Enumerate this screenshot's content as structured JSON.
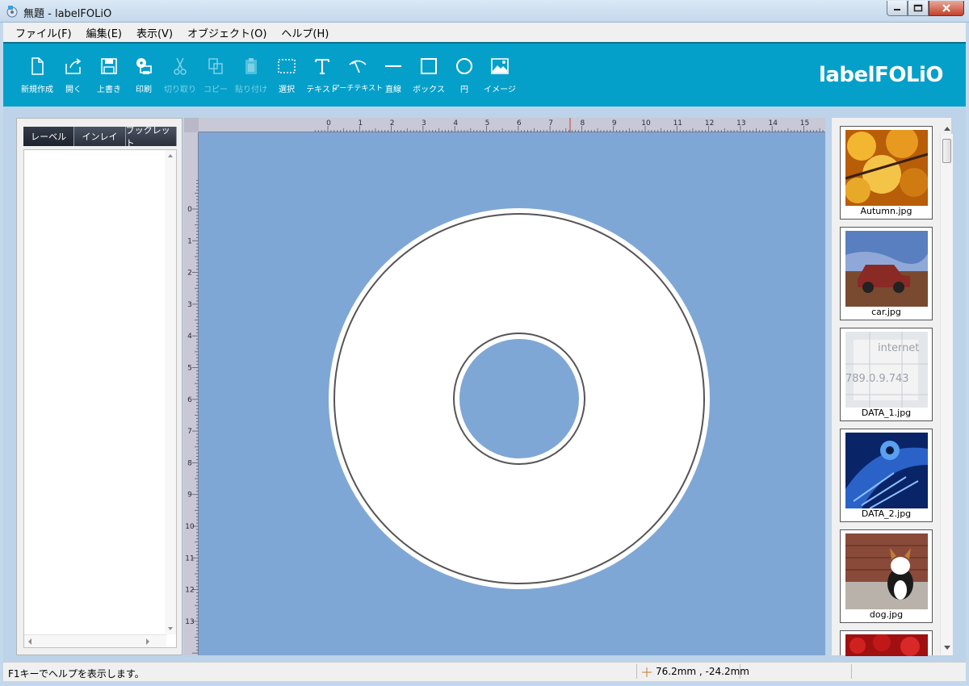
{
  "window": {
    "title": "無題 - labelFOLiO",
    "buttons": [
      "minimize",
      "maximize",
      "close"
    ]
  },
  "menu": [
    "ファイル(F)",
    "編集(E)",
    "表示(V)",
    "オブジェクト(O)",
    "ヘルプ(H)"
  ],
  "toolbar": {
    "tools": [
      {
        "name": "new",
        "label": "新規作成",
        "icon": "new-document-icon",
        "enabled": true
      },
      {
        "name": "open",
        "label": "開く",
        "icon": "open-folder-icon",
        "enabled": true
      },
      {
        "name": "save",
        "label": "上書き",
        "icon": "save-floppy-icon",
        "enabled": true
      },
      {
        "name": "print",
        "label": "印刷",
        "icon": "print-disc-icon",
        "enabled": true
      },
      {
        "name": "cut",
        "label": "切り取り",
        "icon": "scissors-icon",
        "enabled": false
      },
      {
        "name": "copy",
        "label": "コピー",
        "icon": "copy-icon",
        "enabled": false
      },
      {
        "name": "paste",
        "label": "貼り付け",
        "icon": "paste-icon",
        "enabled": false
      },
      {
        "name": "select",
        "label": "選択",
        "icon": "dashed-select-icon",
        "enabled": true
      },
      {
        "name": "text",
        "label": "テキスト",
        "icon": "text-t-icon",
        "enabled": true
      },
      {
        "name": "art-text",
        "label": "アーチテキスト",
        "icon": "arch-text-icon",
        "enabled": true
      },
      {
        "name": "line",
        "label": "直線",
        "icon": "line-icon",
        "enabled": true
      },
      {
        "name": "box",
        "label": "ボックス",
        "icon": "box-icon",
        "enabled": true
      },
      {
        "name": "circle",
        "label": "円",
        "icon": "circle-icon",
        "enabled": true
      },
      {
        "name": "image",
        "label": "イメージ",
        "icon": "image-icon",
        "enabled": true
      }
    ],
    "brand": "labelFOLiO"
  },
  "left_panel": {
    "tabs": [
      "レーベル",
      "インレイ",
      "ブックレット"
    ]
  },
  "ruler": {
    "top_labels": [
      "0",
      "1",
      "2",
      "3",
      "4",
      "5",
      "6",
      "7",
      "8",
      "9",
      "10",
      "11",
      "12",
      "13",
      "14",
      "15"
    ],
    "left_labels": [
      "0",
      "1",
      "2",
      "3",
      "4",
      "5",
      "6",
      "7",
      "8",
      "9",
      "10",
      "11",
      "12",
      "13"
    ]
  },
  "thumbnails": [
    {
      "caption": "Autumn.jpg",
      "colors": [
        "#c86a0c",
        "#f0b020"
      ]
    },
    {
      "caption": "car.jpg",
      "colors": [
        "#4e6fae",
        "#8a3a2a"
      ]
    },
    {
      "caption": "DATA_1.jpg",
      "colors": [
        "#d8dce0",
        "#f5f5f5"
      ]
    },
    {
      "caption": "DATA_2.jpg",
      "colors": [
        "#0b2a7a",
        "#3a7be0"
      ]
    },
    {
      "caption": "dog.jpg",
      "colors": [
        "#8a4a3a",
        "#b8b0a8"
      ]
    },
    {
      "caption": "",
      "colors": [
        "#a01010",
        "#d02020"
      ]
    }
  ],
  "status": {
    "message": "F1キーでヘルプを表示します。",
    "coords": "76.2mm , -24.2mm"
  },
  "colors": {
    "toolbar": "#05a0c9",
    "page": "#7fa7d5",
    "disc": "#ffffff",
    "disc_outline": "#555555"
  }
}
